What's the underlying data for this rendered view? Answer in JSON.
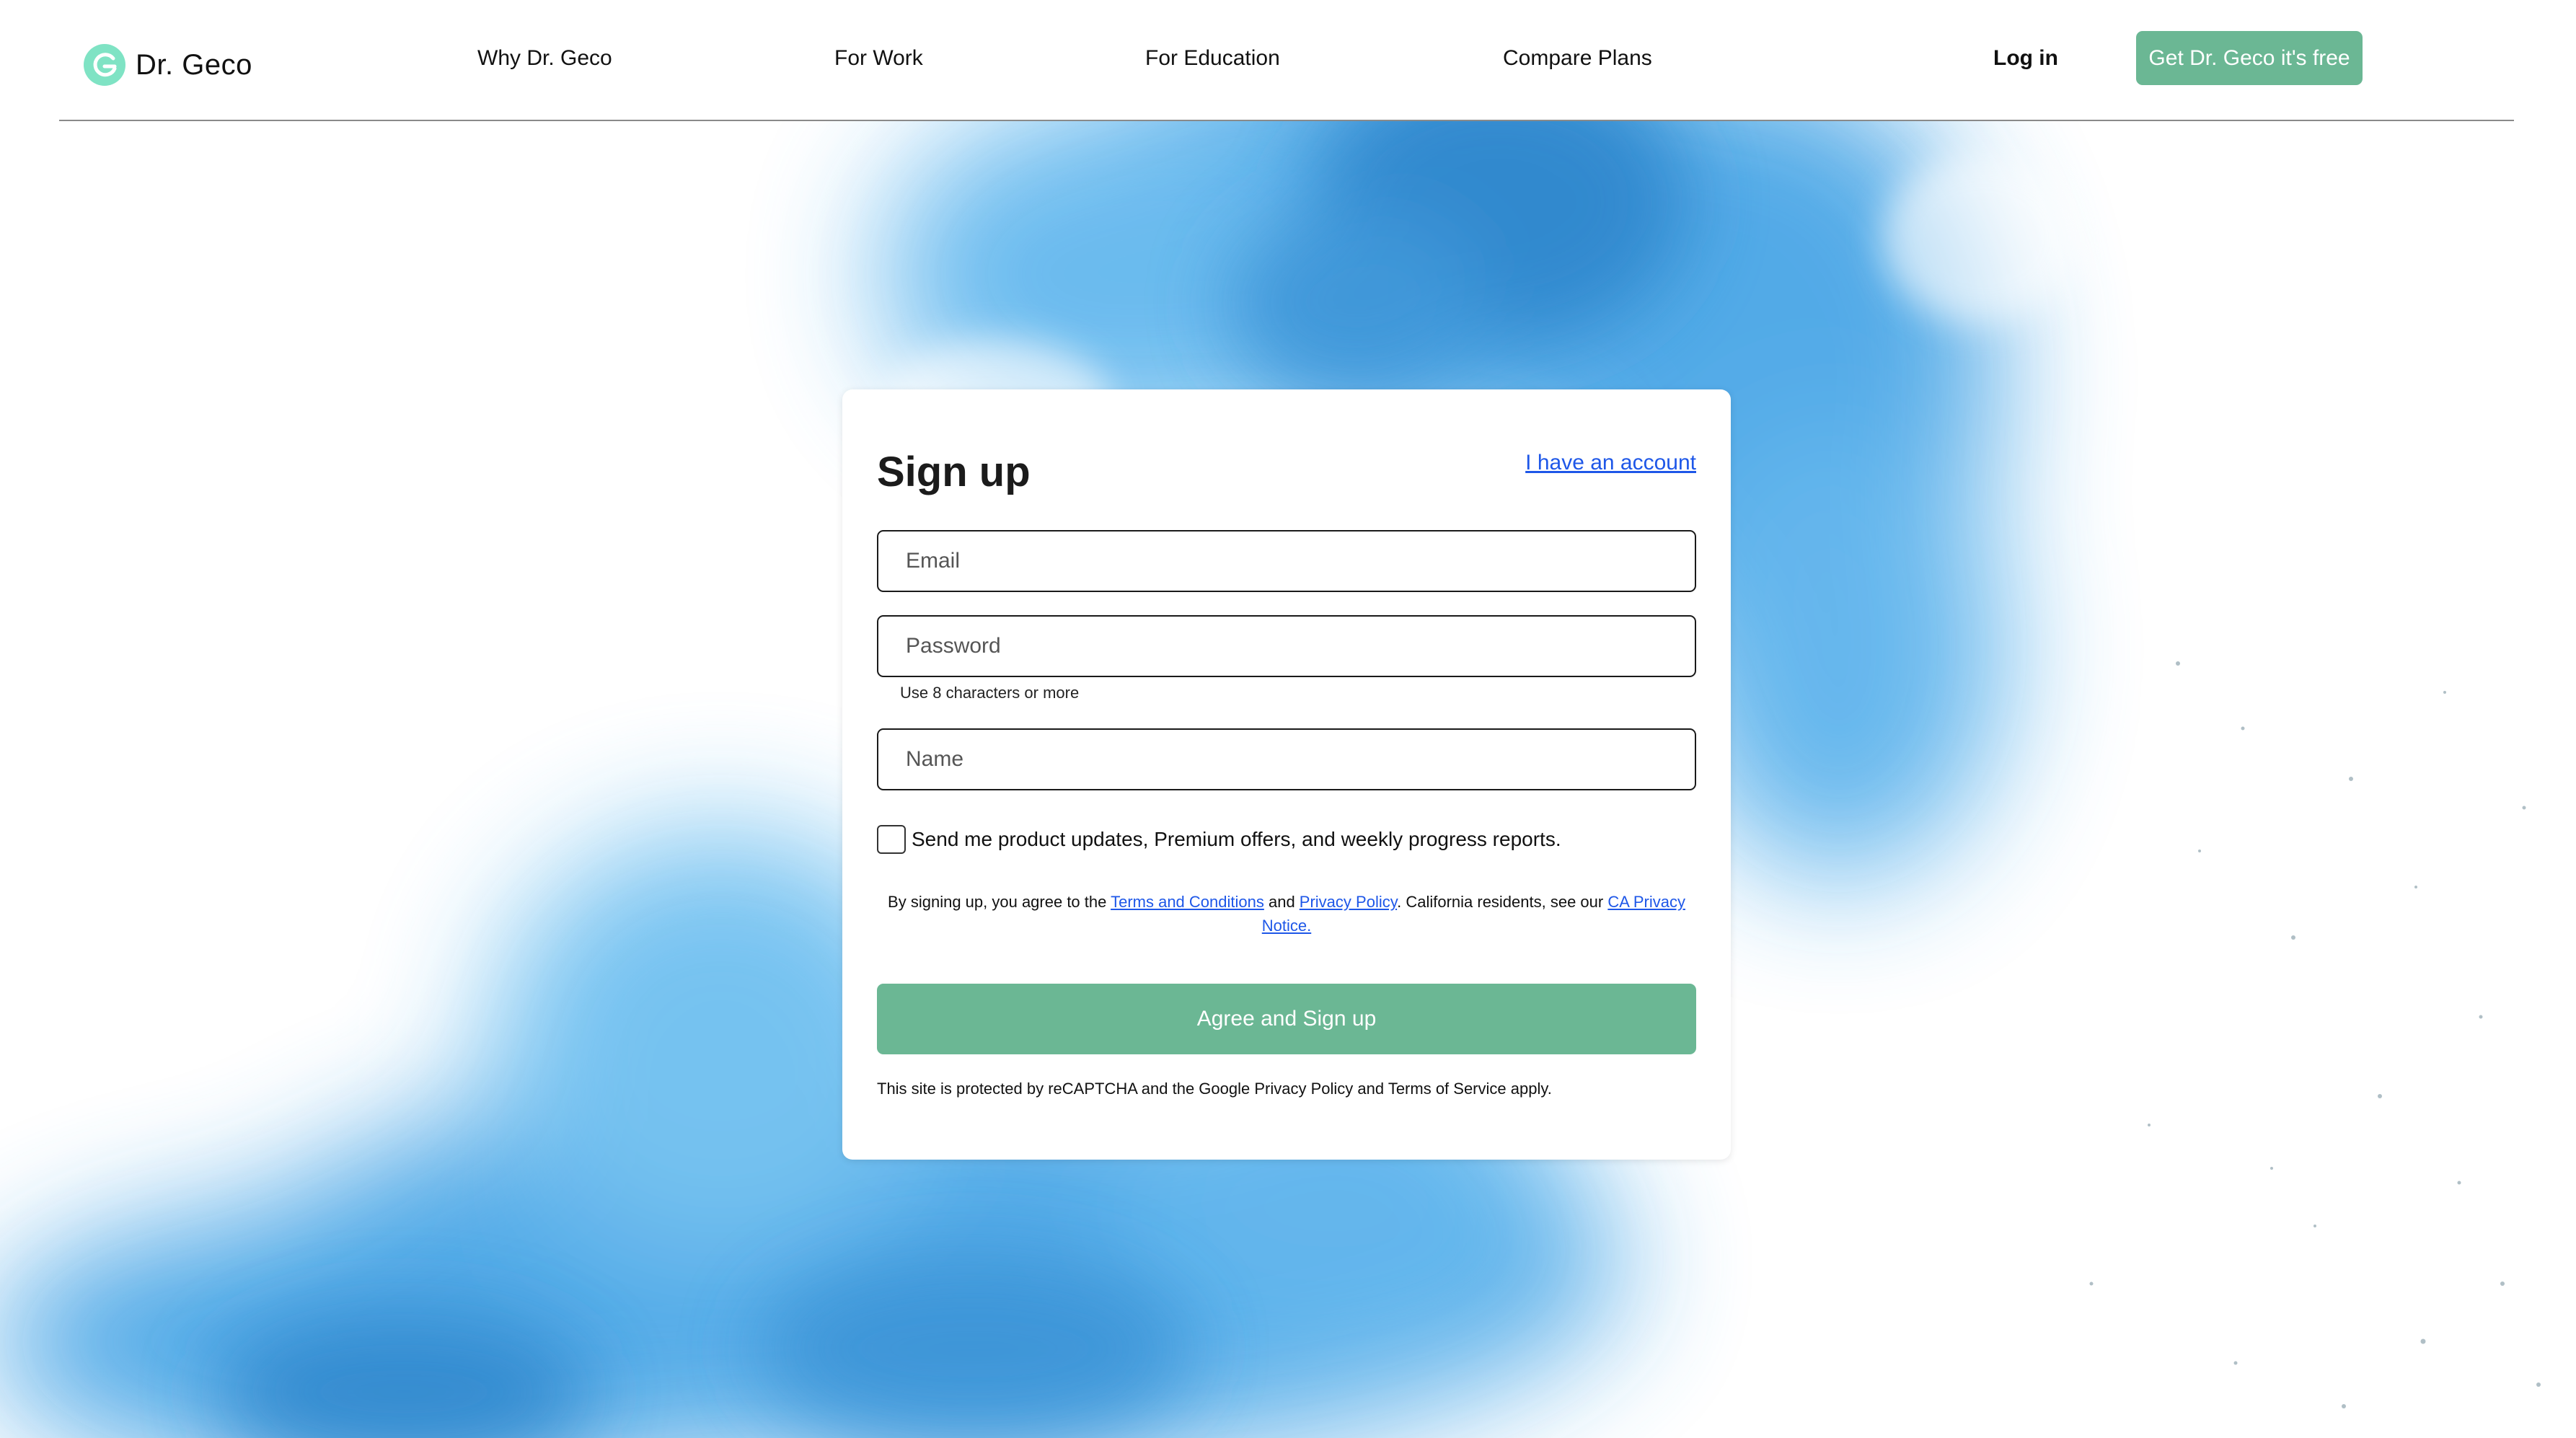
{
  "brand": {
    "name": "Dr. Geco",
    "accent_color": "#6bb794",
    "logo_color": "#7fe3c4",
    "link_color": "#1e57e8"
  },
  "nav": {
    "items": [
      {
        "label": "Why Dr. Geco"
      },
      {
        "label": "For Work"
      },
      {
        "label": "For Education"
      },
      {
        "label": "Compare Plans"
      }
    ],
    "login_label": "Log in",
    "cta_label": "Get Dr. Geco it's free"
  },
  "signup": {
    "title": "Sign up",
    "have_account_label": "I have an account",
    "email_placeholder": "Email",
    "password_placeholder": "Password",
    "password_hint": "Use 8 characters or more",
    "name_placeholder": "Name",
    "marketing_checkbox_label": "Send me product updates, Premium offers, and weekly progress reports.",
    "marketing_checked": false,
    "terms": {
      "prefix": "By signing up, you agree to the ",
      "terms_link": "Terms and Conditions",
      "and": " and ",
      "privacy_link": "Privacy Policy",
      "middle": ". California residents, see our ",
      "ca_link": "CA Privacy Notice."
    },
    "submit_label": "Agree and Sign up",
    "recaptcha_notice": "This site is protected by reCAPTCHA and the Google Privacy Policy and Terms of Service apply."
  }
}
